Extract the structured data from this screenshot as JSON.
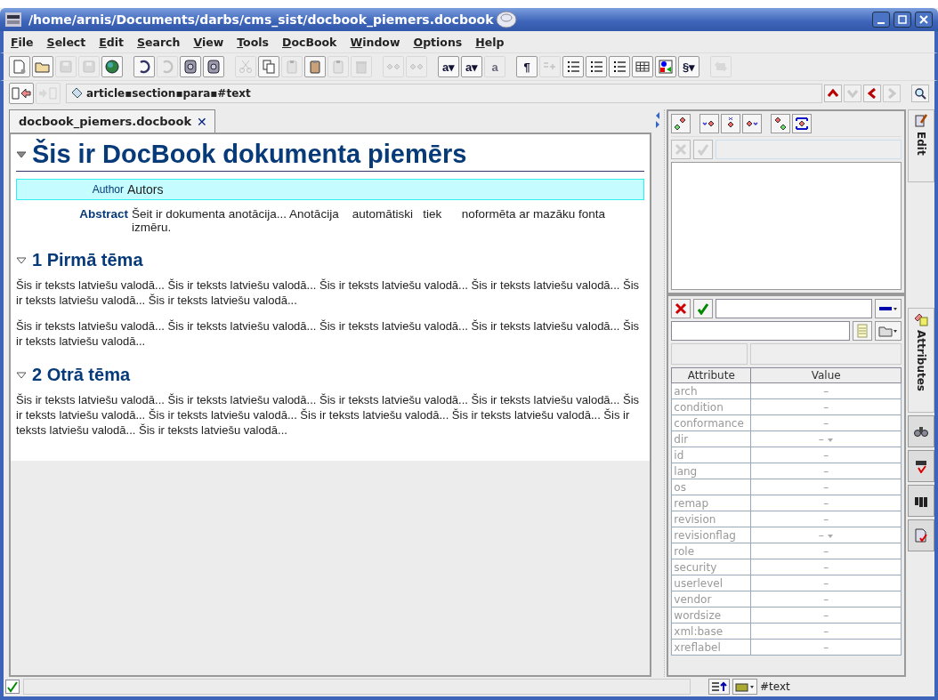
{
  "window": {
    "title": "/home/arnis/Documents/darbs/cms_sist/docbook_piemers.docbook"
  },
  "menu": [
    "File",
    "Select",
    "Edit",
    "Search",
    "View",
    "Tools",
    "DocBook",
    "Window",
    "Options",
    "Help"
  ],
  "toolbar": [
    {
      "disabled": false
    },
    {
      "disabled": false
    },
    {
      "disabled": true
    },
    {
      "disabled": true
    },
    {
      "disabled": false
    },
    {
      "disabled": false
    },
    {
      "disabled": true
    },
    {
      "disabled": false
    },
    {
      "disabled": false
    },
    {
      "disabled": true
    },
    {
      "disabled": false
    },
    {
      "disabled": true
    },
    {
      "disabled": false
    },
    {
      "disabled": true
    },
    {
      "disabled": true
    },
    {
      "disabled": true
    },
    {
      "disabled": true
    },
    {
      "label": "a▾",
      "disabled": false
    },
    {
      "label": "a▾",
      "disabled": false
    },
    {
      "label": "a",
      "disabled": true
    },
    {
      "label": "¶",
      "disabled": false
    },
    {
      "disabled": true
    },
    {
      "disabled": false
    },
    {
      "disabled": false
    },
    {
      "disabled": false
    },
    {
      "disabled": false
    },
    {
      "disabled": false
    },
    {
      "label": "§▾",
      "disabled": false
    },
    {
      "disabled": true
    }
  ],
  "nav": {
    "back_disabled": false,
    "forward_disabled": true,
    "path": "article▪section▪para▪#text"
  },
  "tab": {
    "label": "docbook_piemers.docbook",
    "close": "✕"
  },
  "document": {
    "title": "Šis ir DocBook dokumenta piemērs",
    "expanded": true,
    "author_label": "Author",
    "author": "Autors",
    "abstract_label": "Abstract",
    "abstract": "Šeit ir dokumenta anotācija... Anotācija    automātiski   tiek      noformēta ar mazāku fonta izmēru.",
    "sections": [
      {
        "title": "1 Pirmā tēma",
        "expanded": true,
        "paragraphs": [
          "Šis ir teksts latviešu valodā... Šis ir teksts latviešu valodā... Šis ir teksts latviešu valodā... Šis ir teksts latviešu valodā... Šis ir teksts latviešu valodā... Šis ir teksts latviešu valodā...",
          "Šis ir teksts latviešu valodā... Šis ir teksts latviešu valodā... Šis ir teksts latviešu valodā... Šis ir teksts latviešu valodā... Šis ir teksts latviešu valodā..."
        ]
      },
      {
        "title": "2 Otrā tēma",
        "expanded": true,
        "paragraphs": [
          "Šis ir teksts latviešu valodā... Šis ir teksts latviešu valodā... Šis ir teksts latviešu valodā... Šis ir teksts latviešu valodā... Šis ir teksts latviešu valodā... Šis ir teksts latviešu valodā... Šis ir teksts latviešu valodā... Šis ir teksts latviešu valodā... Šis ir teksts latviešu valodā... Šis ir teksts latviešu valodā..."
        ]
      }
    ]
  },
  "attributes": {
    "columns": [
      "Attribute",
      "Value"
    ],
    "rows": [
      {
        "name": "arch",
        "value": "–",
        "dropdown": false
      },
      {
        "name": "condition",
        "value": "–",
        "dropdown": false
      },
      {
        "name": "conformance",
        "value": "–",
        "dropdown": false
      },
      {
        "name": "dir",
        "value": "–",
        "dropdown": true
      },
      {
        "name": "id",
        "value": "–",
        "dropdown": false
      },
      {
        "name": "lang",
        "value": "–",
        "dropdown": false
      },
      {
        "name": "os",
        "value": "–",
        "dropdown": false
      },
      {
        "name": "remap",
        "value": "–",
        "dropdown": false
      },
      {
        "name": "revision",
        "value": "–",
        "dropdown": false
      },
      {
        "name": "revisionflag",
        "value": "–",
        "dropdown": true
      },
      {
        "name": "role",
        "value": "–",
        "dropdown": false
      },
      {
        "name": "security",
        "value": "–",
        "dropdown": false
      },
      {
        "name": "userlevel",
        "value": "–",
        "dropdown": false
      },
      {
        "name": "vendor",
        "value": "–",
        "dropdown": false
      },
      {
        "name": "wordsize",
        "value": "–",
        "dropdown": false
      },
      {
        "name": "xml:base",
        "value": "–",
        "dropdown": false
      },
      {
        "name": "xreflabel",
        "value": "–",
        "dropdown": false
      }
    ]
  },
  "side_tabs": [
    {
      "kind": "text",
      "label": "Edit"
    },
    {
      "kind": "text",
      "label": "Attributes"
    },
    {
      "kind": "icon"
    },
    {
      "kind": "icon"
    },
    {
      "kind": "icon"
    },
    {
      "kind": "icon"
    }
  ],
  "status_bar": {
    "element": "#text"
  }
}
